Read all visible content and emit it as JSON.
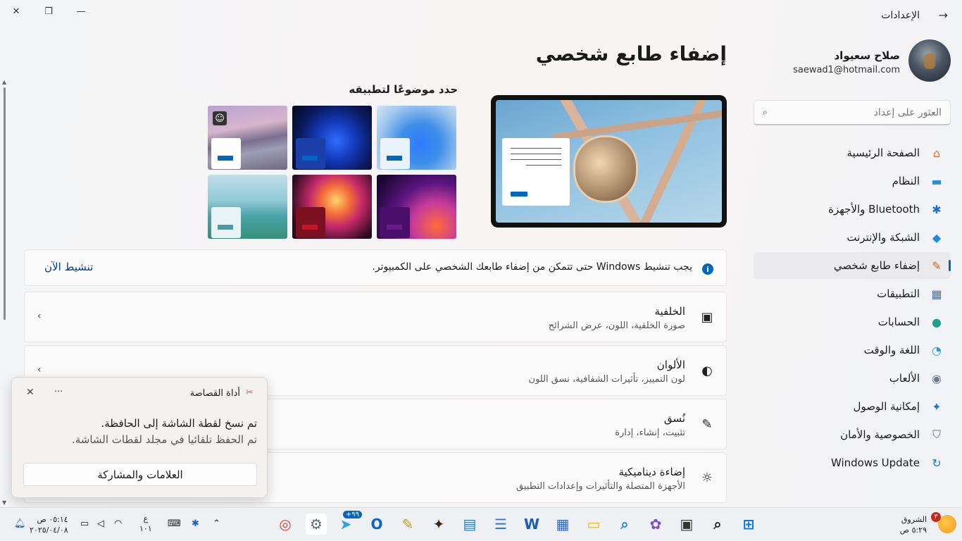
{
  "window": {
    "title": "الإعدادات",
    "controls": {
      "close": "✕",
      "restore": "❐",
      "minimize": "—",
      "back": "→"
    }
  },
  "profile": {
    "name": "صلاح سعيواد",
    "email": "saewad1@hotmail.com"
  },
  "search": {
    "placeholder": "العثور على إعداد"
  },
  "nav": [
    {
      "label": "الصفحة الرئيسية",
      "icon": "home-icon",
      "glyph": "⌂",
      "color": "#e8712a"
    },
    {
      "label": "النظام",
      "icon": "monitor-icon",
      "glyph": "▬",
      "color": "#2a8fd6"
    },
    {
      "label": "Bluetooth والأجهزة",
      "icon": "bluetooth-icon",
      "glyph": "✱",
      "color": "#1b6fd1"
    },
    {
      "label": "الشبكة والإنترنت",
      "icon": "wifi-icon",
      "glyph": "◆",
      "color": "#1e88e5"
    },
    {
      "label": "إضفاء طابع شخصي",
      "icon": "brush-icon",
      "glyph": "✎",
      "color": "#c46b2a"
    },
    {
      "label": "التطبيقات",
      "icon": "apps-icon",
      "glyph": "▦",
      "color": "#4a6fa5"
    },
    {
      "label": "الحسابات",
      "icon": "account-icon",
      "glyph": "●",
      "color": "#1fa08a"
    },
    {
      "label": "اللغة والوقت",
      "icon": "globe-clock-icon",
      "glyph": "◔",
      "color": "#2a9ad8"
    },
    {
      "label": "الألعاب",
      "icon": "gamepad-icon",
      "glyph": "◉",
      "color": "#6b7a8c"
    },
    {
      "label": "إمكانية الوصول",
      "icon": "accessibility-icon",
      "glyph": "✦",
      "color": "#1c7ad4"
    },
    {
      "label": "الخصوصية والأمان",
      "icon": "shield-icon",
      "glyph": "⛉",
      "color": "#6c7683"
    },
    {
      "label": "Windows Update",
      "icon": "update-icon",
      "glyph": "↻",
      "color": "#1e78d6"
    }
  ],
  "nav_active_index": 4,
  "main": {
    "page_title": "إضفاء طابع شخصي",
    "themes_title": "حدد موضوعًا لتطبيقه",
    "themes": [
      {
        "name": "theme-lake",
        "bg": "linear-gradient(170deg,#b9a2d2 0%,#d7b5cc 35%,#7a6f8f 55%,#9e9cb6 70%,#6f6a84 100%)",
        "accent": "#0067c0",
        "mini": "#ffffff",
        "selected": true
      },
      {
        "name": "theme-bloom-dark",
        "bg": "radial-gradient(circle at 55% 55%,#2f6cff 0%,#1438b8 35%,#0a1a5c 65%,#05081c 100%)",
        "accent": "#0067c0",
        "mini": "#1b3fa8",
        "selected": false
      },
      {
        "name": "theme-bloom-light",
        "bg": "radial-gradient(circle at 55% 60%,#2f7bff 0%,#3e8ee8 35%,#9fc6ee 70%,#d3e6f6 100%)",
        "accent": "#0067c0",
        "mini": "#eaf2fb",
        "selected": false
      },
      {
        "name": "theme-coast",
        "bg": "linear-gradient(180deg,#bfe0ea 0%,#93c9d6 40%,#4aa3a8 65%,#3a8f7a 100%)",
        "accent": "#4a9aa8",
        "mini": "#e8f3f5",
        "selected": false
      },
      {
        "name": "theme-glow",
        "bg": "radial-gradient(circle at 55% 40%,#ffd36a 0%,#f26b3a 25%,#c42a6a 45%,#2a0a1f 80%)",
        "accent": "#c81426",
        "mini": "#7a1020",
        "selected": false
      },
      {
        "name": "theme-captured-motion",
        "bg": "radial-gradient(circle at 75% 80%,#ff6a3a 0%,#c73b9a 30%,#5a1580 55%,#1a0630 90%)",
        "accent": "#6a1a8a",
        "mini": "#4a0f6a",
        "selected": false
      }
    ],
    "activation": {
      "message": "يجب تنشيط Windows حتى تتمكن من إضفاء طابعك الشخصي على الكمبيوتر.",
      "link": "تنشيط الآن"
    },
    "cards": [
      {
        "title": "الخلفية",
        "subtitle": "صورة الخلفية، اللون، عرض الشرائح",
        "icon": "image-icon",
        "glyph": "▣"
      },
      {
        "title": "الألوان",
        "subtitle": "لون التمييز، تأثيرات الشفافية، نسق اللون",
        "icon": "palette-icon",
        "glyph": "◐"
      },
      {
        "title": "نُسق",
        "subtitle": "تثبيت، إنشاء، إدارة",
        "icon": "pen-icon",
        "glyph": "✎"
      },
      {
        "title": "إضاءة ديناميكية",
        "subtitle": "الأجهزة المتصلة والتأثيرات وإعدادات التطبيق",
        "icon": "sun-icon",
        "glyph": "☼"
      }
    ]
  },
  "toast": {
    "app": "أداة القصاصة",
    "line1": "تم نسخ لقطة الشاشة إلى الحافظة.",
    "line2": "تم الحفظ تلقائيا في مجلد لقطات الشاشة.",
    "button": "العلامات والمشاركة",
    "more": "···",
    "close": "✕"
  },
  "taskbar": {
    "time": "٠٥:١٤ ص",
    "date": "٢٠٢٥/٠٤/٠٨",
    "lang_top": "ع",
    "lang_bottom": "١٠١",
    "weather_label": "الشروق",
    "weather_time": "٥:٢٩ ص",
    "weather_badge": "٣",
    "telegram_badge": "+٩٩",
    "apps": [
      {
        "name": "chrome-icon",
        "color": "#db4437",
        "glyph": "◎"
      },
      {
        "name": "settings-icon",
        "color": "#5b6b7c",
        "glyph": "⚙"
      },
      {
        "name": "telegram-icon",
        "color": "#2aa3e0",
        "glyph": "➤"
      },
      {
        "name": "outlook-icon",
        "color": "#0a64c8",
        "glyph": "O"
      },
      {
        "name": "notes-app-icon",
        "color": "#c79a2a",
        "glyph": "✎"
      },
      {
        "name": "photo-app-icon",
        "color": "#3a2a1a",
        "glyph": "✦"
      },
      {
        "name": "presenter-icon",
        "color": "#1a7ad4",
        "glyph": "▤"
      },
      {
        "name": "notepad-icon",
        "color": "#2a7ad8",
        "glyph": "☰"
      },
      {
        "name": "word-icon",
        "color": "#185abd",
        "glyph": "W"
      },
      {
        "name": "store-icon",
        "color": "#2a6ad8",
        "glyph": "▦"
      },
      {
        "name": "file-explorer-icon",
        "color": "#f2b80f",
        "glyph": "▭"
      },
      {
        "name": "search-app-icon",
        "color": "#1a8ad8",
        "glyph": "⌕"
      },
      {
        "name": "copilot-icon",
        "color": "#7a4ad8",
        "glyph": "✿"
      },
      {
        "name": "task-view-icon",
        "color": "#333333",
        "glyph": "▣"
      },
      {
        "name": "taskbar-search-icon",
        "color": "#222222",
        "glyph": "⌕"
      },
      {
        "name": "start-icon",
        "color": "#0a7ad8",
        "glyph": "⊞"
      }
    ]
  }
}
